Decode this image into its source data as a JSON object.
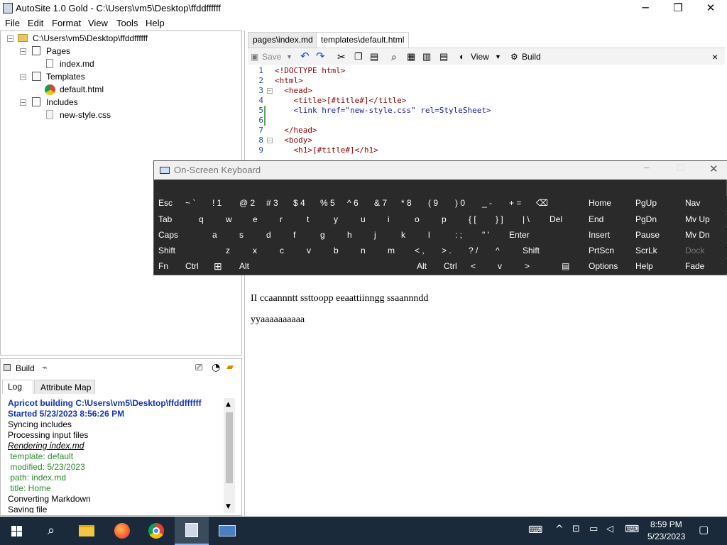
{
  "window": {
    "title": "AutoSite 1.0 Gold - C:\\Users\\vm5\\Desktop\\ffddffffff",
    "minimize": "─",
    "maximize": "❐",
    "close": "✕"
  },
  "menu": [
    "File",
    "Edit",
    "Format",
    "View",
    "Tools",
    "Help"
  ],
  "tree": {
    "root": "C:\\Users\\vm5\\Desktop\\ffddffffff",
    "pages": "Pages",
    "page1": "index.md",
    "templates": "Templates",
    "template1": "default.html",
    "includes": "Includes",
    "include1": "new-style.css"
  },
  "build_panel": {
    "build_label": "Build",
    "tabs": [
      "Log",
      "Attribute Map"
    ],
    "log": [
      {
        "text": "Apricot building C:\\Users\\vm5\\Desktop\\ffddffffff",
        "style": "blue-bold"
      },
      {
        "text": "Started 5/23/2023 8:56:26 PM",
        "style": "blue-bold"
      },
      {
        "text": "Syncing includes",
        "style": "normal"
      },
      {
        "text": "Processing input files",
        "style": "normal"
      },
      {
        "text": "Rendering index.md",
        "style": "italic-underline"
      },
      {
        "text": " template: default",
        "style": "green"
      },
      {
        "text": " modified: 5/23/2023",
        "style": "green"
      },
      {
        "text": " path: index.md",
        "style": "green"
      },
      {
        "text": " title: Home",
        "style": "green"
      },
      {
        "text": "Converting Markdown",
        "style": "normal"
      },
      {
        "text": "Saving file",
        "style": "normal"
      }
    ]
  },
  "editor": {
    "tabs": [
      "pages\\index.md",
      "templates\\default.html"
    ],
    "active_tab": 1,
    "toolbar": {
      "save": "Save",
      "view": "View",
      "build": "Build",
      "close": "×"
    },
    "lines": [
      {
        "n": "1",
        "text": "<!DOCTYPE html>"
      },
      {
        "n": "2",
        "text": "<html>"
      },
      {
        "n": "3",
        "text": "  <head>"
      },
      {
        "n": "4",
        "text": "    <title>[#title#]</title>"
      },
      {
        "n": "5",
        "text": "    <link href=\"new-style.css\" rel=StyleSheet>"
      },
      {
        "n": "6",
        "text": ""
      },
      {
        "n": "7",
        "text": "  </head>"
      },
      {
        "n": "8",
        "text": "  <body>"
      },
      {
        "n": "9",
        "text": "    <h1>[#title#]</h1>"
      }
    ]
  },
  "osk": {
    "title": "On-Screen Keyboard",
    "rows": [
      [
        "Esc",
        "~ `",
        "! 1",
        "@ 2",
        "# 3",
        "$ 4",
        "% 5",
        "^ 6",
        "& 7",
        "* 8",
        "( 9",
        ") 0",
        "_ -",
        "+ =",
        "⌫"
      ],
      [
        "Tab",
        "q",
        "w",
        "e",
        "r",
        "t",
        "y",
        "u",
        "i",
        "o",
        "p",
        "{ [",
        "} ]",
        "| \\",
        "Del"
      ],
      [
        "Caps",
        "a",
        "s",
        "d",
        "f",
        "g",
        "h",
        "j",
        "k",
        "l",
        ": ;",
        "\" '",
        "Enter"
      ],
      [
        "Shift",
        "z",
        "x",
        "c",
        "v",
        "b",
        "n",
        "m",
        "< ,",
        "> .",
        "? /",
        "^",
        "Shift"
      ],
      [
        "Fn",
        "Ctrl",
        "⊞",
        "Alt",
        "",
        "Alt",
        "Ctrl",
        "<",
        "v",
        ">",
        "▤"
      ]
    ],
    "nav": [
      [
        "Home",
        "PgUp",
        "Nav"
      ],
      [
        "End",
        "PgDn",
        "Mv Up"
      ],
      [
        "Insert",
        "Pause",
        "Mv Dn"
      ],
      [
        "PrtScn",
        "ScrLk",
        "Dock"
      ],
      [
        "Options",
        "Help",
        "Fade"
      ]
    ]
  },
  "preview": {
    "line1": "II ccaannntt ssttoopp eeaattiinngg ssaannndd",
    "line2": "yyaaaaaaaaaa"
  },
  "taskbar": {
    "time": "8:59 PM",
    "date": "5/23/2023"
  }
}
